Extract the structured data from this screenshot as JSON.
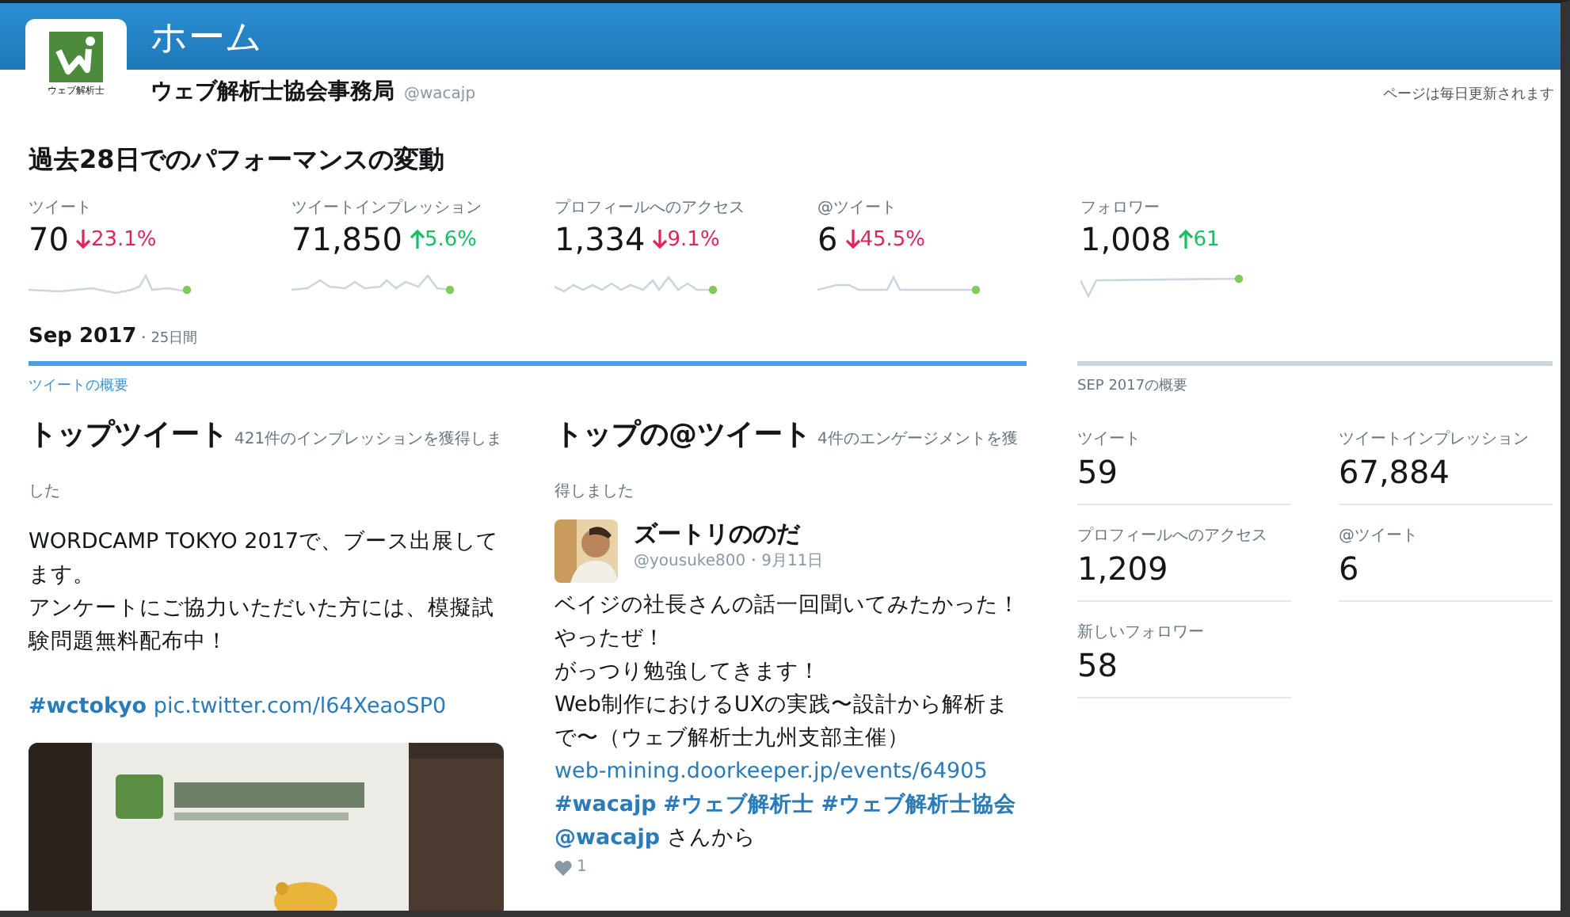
{
  "header": {
    "title": "ホーム",
    "account_name": "ウェブ解析士協会事務局",
    "handle": "@wacajp",
    "logo_caption": "ウェブ解析士",
    "update_note": "ページは毎日更新されます"
  },
  "performance": {
    "title": "過去28日でのパフォーマンスの変動",
    "metrics": [
      {
        "label": "ツイート",
        "value": "70",
        "kind": "down",
        "change": "23.1%"
      },
      {
        "label": "ツイートインプレッション",
        "value": "71,850",
        "kind": "up",
        "change": "5.6%"
      },
      {
        "label": "プロフィールへのアクセス",
        "value": "1,334",
        "kind": "down",
        "change": "9.1%"
      },
      {
        "label": "@ツイート",
        "value": "6",
        "kind": "down",
        "change": "45.5%"
      },
      {
        "label": "フォロワー",
        "value": "1,008",
        "kind": "up",
        "change": "61"
      }
    ]
  },
  "period": {
    "month": "Sep 2017",
    "days": "・25日間"
  },
  "tweet_summary": {
    "label": "ツイートの概要",
    "top_tweet": {
      "title": "トップツイート",
      "subtitle": "421件のインプレッションを獲得しました",
      "paragraphs": [
        [
          {
            "kind": "text",
            "text": "WORDCAMP TOKYO 2017で、ブース出展してます。"
          }
        ],
        [
          {
            "kind": "text",
            "text": "アンケートにご協力いただいた方には、模擬試験問題無料配布中！"
          }
        ],
        [
          {
            "kind": "hashtag",
            "text": "#wctokyo"
          },
          {
            "kind": "link",
            "text": "pic.twitter.com/l64XeaoSP0"
          }
        ]
      ],
      "media": {
        "kind": "picture"
      }
    },
    "top_mention": {
      "title": "トップの@ツイート",
      "subtitle": "4件のエンゲージメントを獲得しました",
      "author": "ズートリののだ",
      "author_handle": "@yousuke800",
      "date": "・9月11日",
      "paragraphs": [
        [
          {
            "kind": "text",
            "text": "ベイジの社長さんの話一回聞いてみたかった！やったぜ！"
          }
        ],
        [
          {
            "kind": "text",
            "text": "がっつり勉強してきます！"
          }
        ],
        [
          {
            "kind": "text",
            "text": "Web制作におけるUXの実践〜設計から解析まで〜（ウェブ解析士九州支部主催）"
          },
          {
            "kind": "link",
            "text": "web-mining.doorkeeper.jp/events/64905"
          },
          {
            "kind": "hashtag",
            "text": "#wacajp"
          },
          {
            "kind": "hashtag",
            "text": "#ウェブ解析士"
          },
          {
            "kind": "hashtag",
            "text": "#ウェブ解析士協会"
          },
          {
            "kind": "hashtag",
            "text": "@wacajp"
          },
          {
            "kind": "text",
            "text": "さんから"
          }
        ]
      ],
      "likes": "1"
    }
  },
  "month_summary": {
    "label": "SEP 2017の概要",
    "stats": [
      {
        "label": "ツイート",
        "value": "59"
      },
      {
        "label": "ツイートインプレッション",
        "value": "67,884"
      },
      {
        "label": "プロフィールへのアクセス",
        "value": "1,209"
      },
      {
        "label": "@ツイート",
        "value": "6"
      },
      {
        "label": "新しいフォロワー",
        "value": "58"
      }
    ]
  }
}
